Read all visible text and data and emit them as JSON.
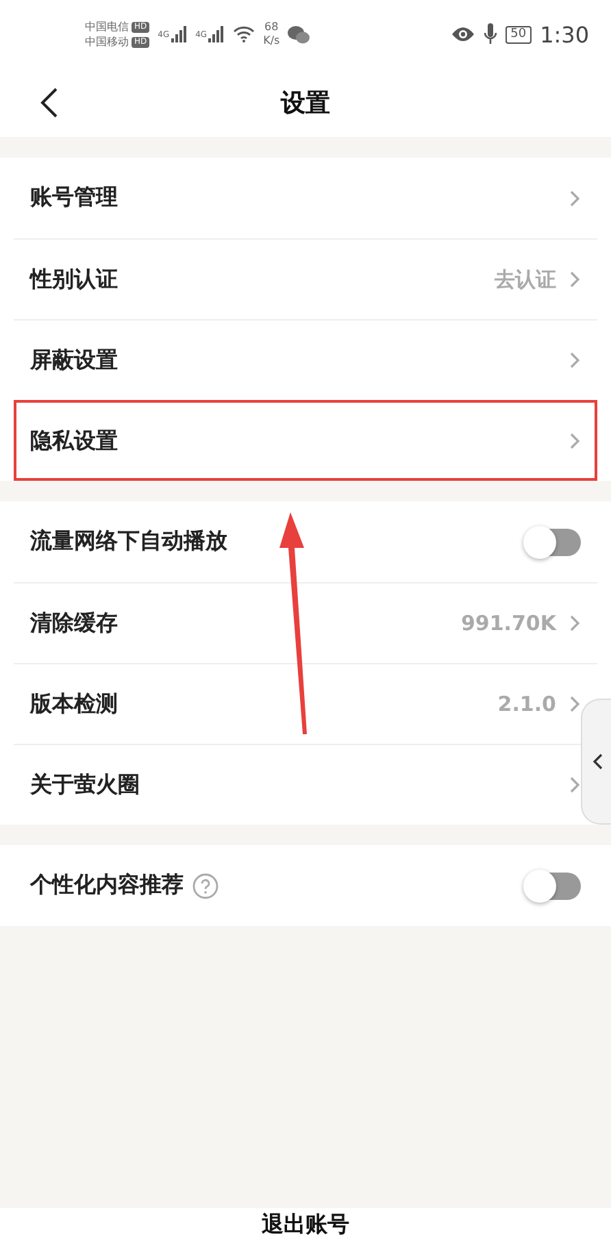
{
  "status_bar": {
    "carriers": [
      {
        "name": "中国电信",
        "badge": "HD"
      },
      {
        "name": "中国移动",
        "badge": "HD"
      }
    ],
    "signals": [
      "4G",
      "4G"
    ],
    "speed": "68",
    "speed_unit": "K/s",
    "battery": "50",
    "time": "1:30"
  },
  "header": {
    "title": "设置"
  },
  "sections": [
    {
      "rows": [
        {
          "kind": "link",
          "label": "账号管理",
          "highlighted": false
        },
        {
          "kind": "link",
          "label": "性别认证",
          "value": "去认证",
          "highlighted": false
        },
        {
          "kind": "link",
          "label": "屏蔽设置",
          "highlighted": false
        },
        {
          "kind": "link",
          "label": "隐私设置",
          "highlighted": true
        }
      ]
    },
    {
      "rows": [
        {
          "kind": "toggle",
          "label": "流量网络下自动播放",
          "on": false,
          "highlighted": false
        },
        {
          "kind": "link",
          "label": "清除缓存",
          "value": "991.70K",
          "highlighted": false
        },
        {
          "kind": "link",
          "label": "版本检测",
          "value": "2.1.0",
          "highlighted": false
        },
        {
          "kind": "link",
          "label": "关于萤火圈",
          "highlighted": false
        }
      ]
    },
    {
      "rows": [
        {
          "kind": "toggle",
          "label": "个性化内容推荐",
          "help": true,
          "on": false,
          "highlighted": false
        }
      ]
    }
  ],
  "logout": "退出账号"
}
